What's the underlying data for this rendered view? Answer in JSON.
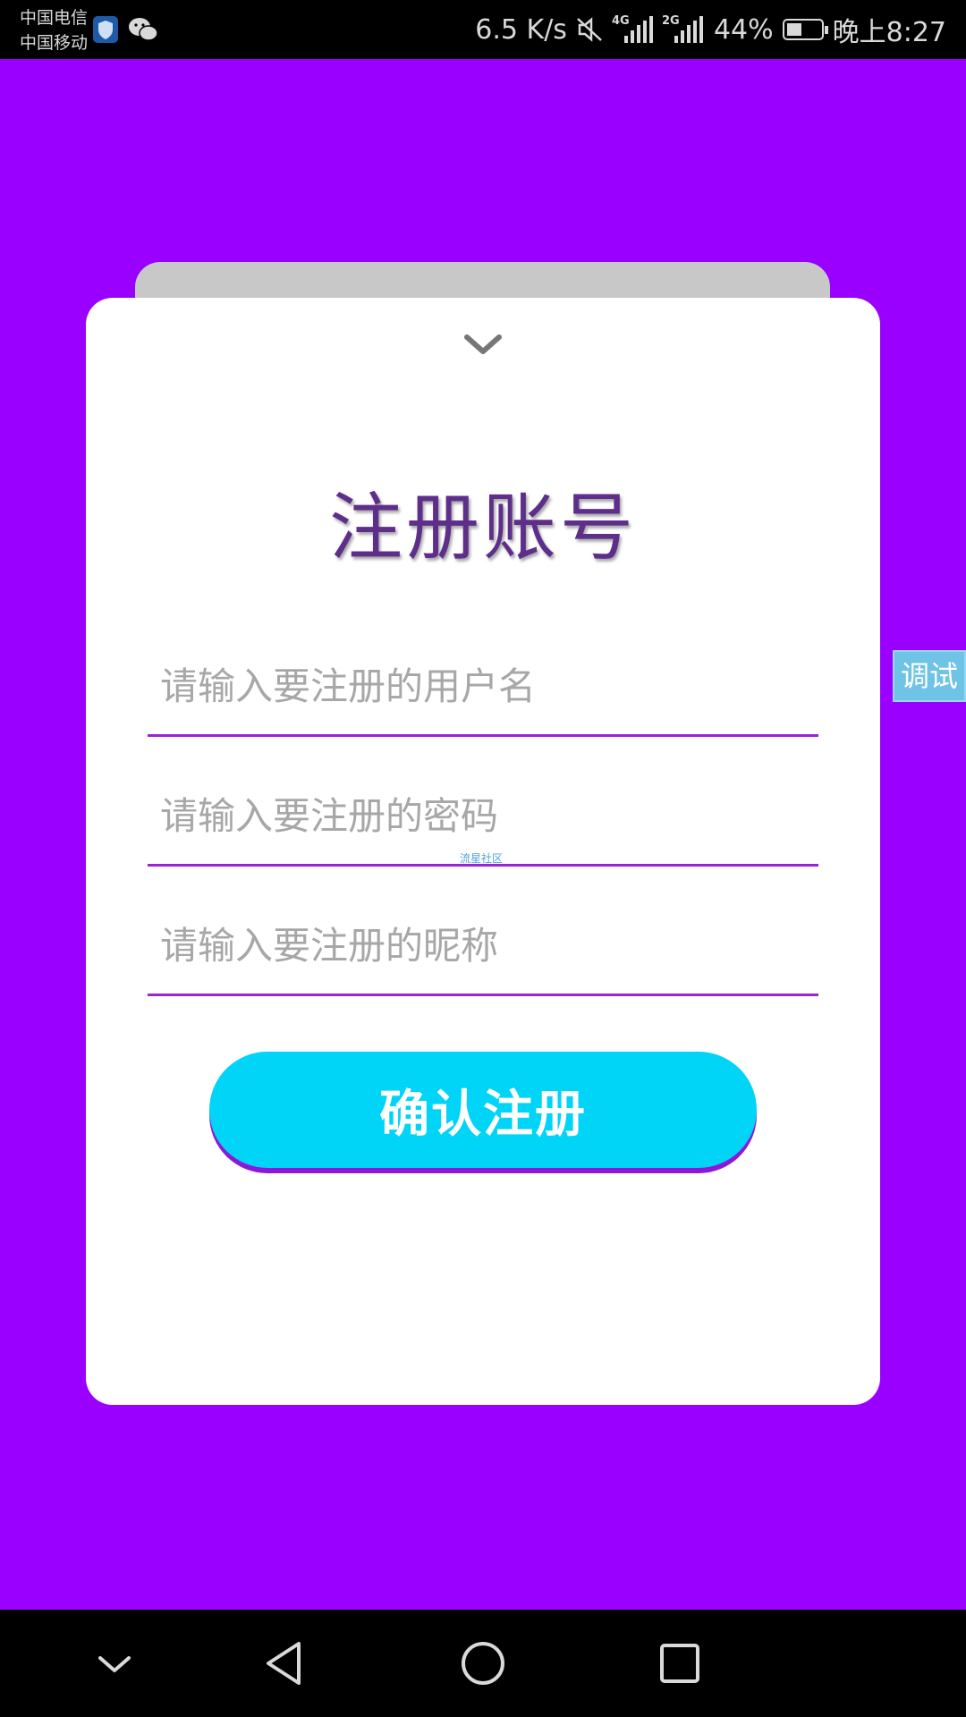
{
  "status_bar": {
    "carrier_1": "中国电信",
    "carrier_2": "中国移动",
    "net_speed": "6.5 K/s",
    "sig1_label": "4G",
    "sig2_label": "2G",
    "battery_pct": "44%",
    "battery_level": 0.44,
    "time": "晚上8:27",
    "icons": [
      "shield-icon",
      "wechat-icon",
      "mute-icon",
      "signal-icon",
      "battery-icon"
    ]
  },
  "form": {
    "title": "注册账号",
    "username_placeholder": "请输入要注册的用户名",
    "password_placeholder": "请输入要注册的密码",
    "nickname_placeholder": "请输入要注册的昵称",
    "submit_label": "确认注册",
    "watermark": "流星社区"
  },
  "debug_label": "调试",
  "colors": {
    "background": "#9900ff",
    "button": "#00d4f7",
    "title": "#5e2f8a",
    "underline": "#9c22d6"
  }
}
